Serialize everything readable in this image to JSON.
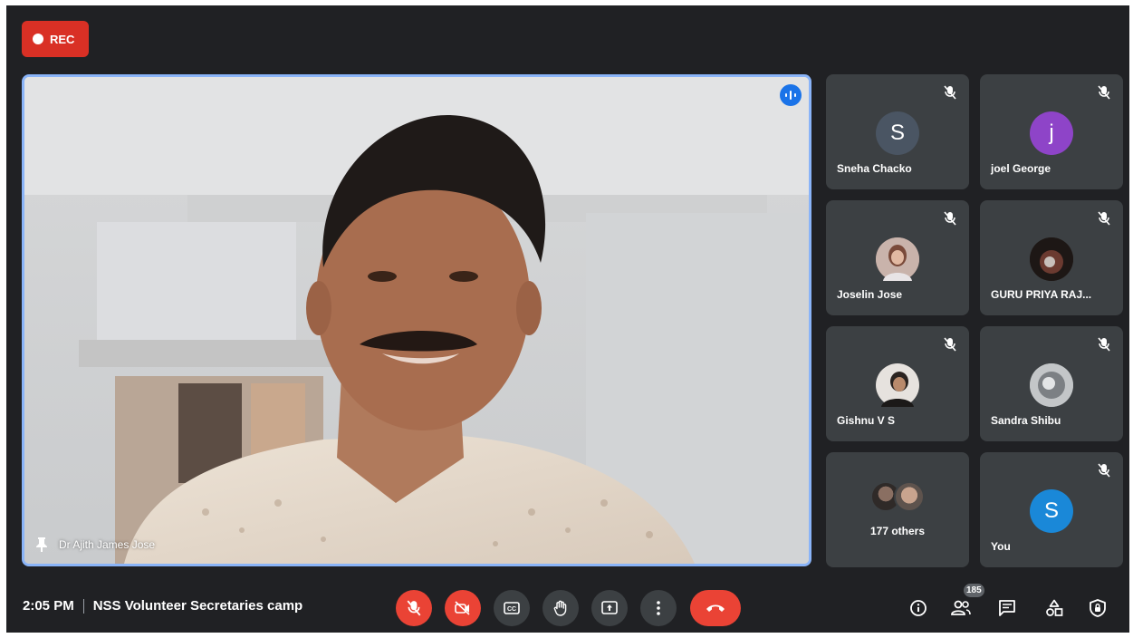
{
  "recording": {
    "label": "REC",
    "color": "#d93025"
  },
  "main_speaker": {
    "name": "Dr Ajith James Jose",
    "speaking_icon": "audio-waveform-icon",
    "pin_icon": "pin-icon"
  },
  "participants": [
    {
      "name": "Sneha Chacko",
      "initial": "S",
      "avatar_color": "#4a5563",
      "muted": true
    },
    {
      "name": "joel George",
      "initial": "j",
      "avatar_color": "#8e44c8",
      "muted": true
    },
    {
      "name": "Joselin Jose",
      "initial": "",
      "avatar_color": "#a78b86",
      "muted": true
    },
    {
      "name": "GURU PRIYA RAJ...",
      "initial": "",
      "avatar_color": "#2b2320",
      "muted": true
    },
    {
      "name": "Gishnu V S",
      "initial": "",
      "avatar_color": "#4b4440",
      "muted": true
    },
    {
      "name": "Sandra Shibu",
      "initial": "",
      "avatar_color": "#9fa3a6",
      "muted": true
    },
    {
      "name": "177 others",
      "initial": "",
      "avatar_color": "#5a5450",
      "muted": false
    },
    {
      "name": "You",
      "initial": "S",
      "avatar_color": "#1a88d8",
      "muted": true
    }
  ],
  "footer": {
    "time": "2:05 PM",
    "meeting_title": "NSS Volunteer Secretaries camp",
    "participant_count": "185"
  },
  "controls": [
    {
      "name": "mic-off-icon",
      "color": "#ea4335"
    },
    {
      "name": "camera-off-icon",
      "color": "#ea4335"
    },
    {
      "name": "captions-icon",
      "color": "#3c4043"
    },
    {
      "name": "raise-hand-icon",
      "color": "#3c4043"
    },
    {
      "name": "present-screen-icon",
      "color": "#3c4043"
    },
    {
      "name": "more-options-icon",
      "color": "#3c4043"
    },
    {
      "name": "end-call-icon",
      "color": "#ea4335"
    }
  ],
  "right_icons": [
    "info-icon",
    "people-icon",
    "chat-icon",
    "activities-icon",
    "host-controls-icon"
  ]
}
